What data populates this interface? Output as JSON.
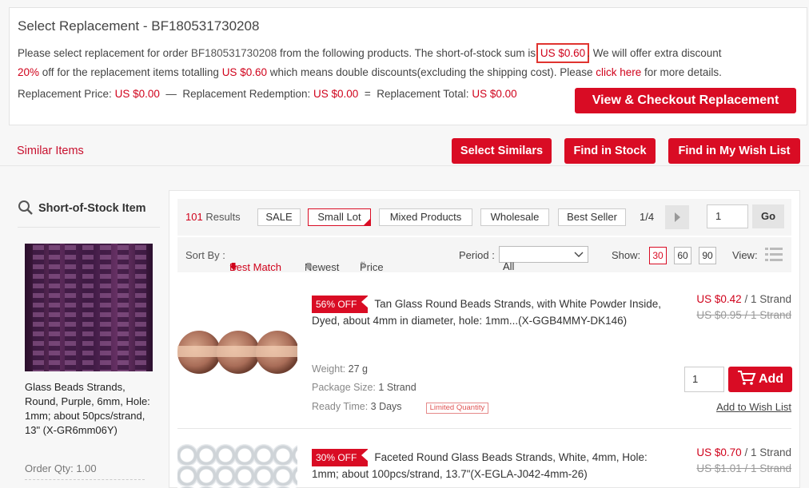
{
  "replacement": {
    "title": "Select Replacement - BF180531730208",
    "line1_a": "Please select replacement for order",
    "order_no": "BF180531730208",
    "line1_b": "from the following products. The short-of-stock sum is",
    "sum": "US $0.60",
    "line1_c": ". We will offer extra discount",
    "pct": "20%",
    "line2_a": "off for the replacement items totalling",
    "total": "US $0.60",
    "line2_b": "which means double discounts(excluding the shipping cost). Please",
    "click_here": "click here",
    "line2_c": "for more details.",
    "price_label": "Replacement Price:",
    "price_value": "US $0.00",
    "minus": "—",
    "redemption_label": "Replacement Redemption:",
    "redemption_value": "US $0.00",
    "equals": "=",
    "total_label": "Replacement Total:",
    "total_value": "US $0.00",
    "view_button": "View & Checkout Replacement"
  },
  "similar": {
    "label": "Similar Items",
    "select_similars": "Select Similars",
    "find_in_stock": "Find in Stock",
    "find_wishlist": "Find in My Wish List"
  },
  "short_item": {
    "title": "Short-of-Stock Item",
    "desc": "Glass Beads Strands, Round, Purple, 6mm, Hole: 1mm; about 50pcs/strand, 13\" (X-GR6mm06Y)",
    "qty_label": "Order Qty:",
    "qty_value": "1.00"
  },
  "filters": {
    "count": "101",
    "results_label": "Results",
    "chips": [
      "SALE",
      "Small Lot",
      "Mixed Products",
      "Wholesale",
      "Best Seller"
    ],
    "active_chip": "Small Lot",
    "page_info": "1/4",
    "page_input": "1",
    "go": "Go"
  },
  "sort": {
    "label": "Sort By :",
    "best_match": "Best Match",
    "newest": "Newest",
    "price": "Price",
    "period_label": "Period :",
    "period_value": "All",
    "show_label": "Show:",
    "show_options": [
      "30",
      "60",
      "90"
    ],
    "show_active": "30",
    "view_label": "View:"
  },
  "items": [
    {
      "off": "56% OFF",
      "title": "Tan Glass Round Beads Strands, with White Powder Inside, Dyed, about 4mm in diameter, hole: 1mm...(X-GGB4MMY-DK146)",
      "weight_label": "Weight:",
      "weight": "27 g",
      "pkg_label": "Package Size:",
      "pkg": "1 Strand",
      "ready_label": "Ready Time:",
      "ready": "3 Days",
      "limited": "Limited Quantity",
      "price_now": "US $0.42",
      "price_unit": "/ 1 Strand",
      "price_was": "US $0.95 / 1 Strand",
      "qty": "1",
      "add": "Add",
      "wish": "Add to Wish List"
    },
    {
      "off": "30% OFF",
      "title": "Faceted Round Glass Beads Strands, White, 4mm, Hole: 1mm; about 100pcs/strand, 13.7\"(X-EGLA-J042-4mm-26)",
      "price_now": "US $0.70",
      "price_unit": "/ 1 Strand",
      "price_was": "US $1.01 / 1 Strand"
    }
  ],
  "colors": {
    "accent": "#d90c24",
    "text": "#333333",
    "bg": "#f7f7f7"
  }
}
